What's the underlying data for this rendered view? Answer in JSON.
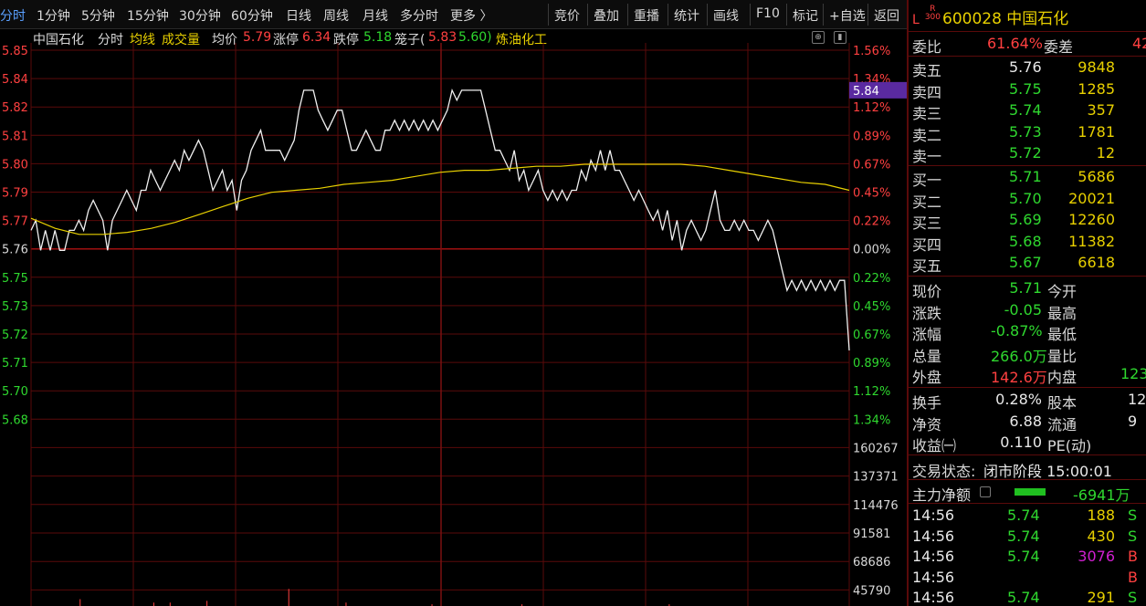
{
  "toolbar": {
    "left_items": [
      "分时",
      "1分钟",
      "5分钟",
      "15分钟",
      "30分钟",
      "60分钟",
      "日线",
      "周线",
      "月线",
      "多分时",
      "更多 〉"
    ],
    "right_items": [
      "竞价",
      "叠加",
      "重播",
      "统计",
      "画线",
      "F10",
      "标记",
      "+自选",
      "返回"
    ]
  },
  "chart_header": {
    "name": "中国石化",
    "mode": "分时",
    "avg_line": "均线",
    "volume": "成交量",
    "avg_label": "均价",
    "avg_value": "5.79",
    "limit_up_label": "涨停",
    "limit_up_value": "6.34",
    "limit_down_label": "跌停",
    "limit_down_value": "5.18",
    "cage_label": "笼子(",
    "cage_high": "5.83",
    "cage_low": "5.60)",
    "sector": "炼油化工"
  },
  "chart_data": {
    "type": "line",
    "price_ticks": [
      "5.85",
      "5.84",
      "5.82",
      "5.81",
      "5.80",
      "5.79",
      "5.77",
      "5.76",
      "5.75",
      "5.73",
      "5.72",
      "5.71",
      "5.70",
      "5.68"
    ],
    "pct_ticks": [
      "1.56%",
      "1.34%",
      "1.12%",
      "0.89%",
      "0.67%",
      "0.45%",
      "0.22%",
      "0.00%",
      "0.22%",
      "0.45%",
      "0.67%",
      "0.89%",
      "1.12%",
      "1.34%"
    ],
    "volume_ticks": [
      "160267",
      "137371",
      "114476",
      "91581",
      "68686",
      "45790"
    ],
    "price_marker": "5.84",
    "prev_close": 5.76,
    "price_range": [
      5.67,
      5.86
    ],
    "price_series": [
      5.77,
      5.775,
      5.76,
      5.77,
      5.76,
      5.77,
      5.76,
      5.76,
      5.77,
      5.77,
      5.775,
      5.77,
      5.78,
      5.785,
      5.78,
      5.775,
      5.76,
      5.775,
      5.78,
      5.785,
      5.79,
      5.785,
      5.78,
      5.79,
      5.79,
      5.8,
      5.795,
      5.79,
      5.795,
      5.8,
      5.805,
      5.8,
      5.81,
      5.805,
      5.81,
      5.815,
      5.81,
      5.8,
      5.79,
      5.795,
      5.8,
      5.79,
      5.795,
      5.78,
      5.795,
      5.8,
      5.81,
      5.815,
      5.82,
      5.81,
      5.81,
      5.81,
      5.81,
      5.805,
      5.81,
      5.815,
      5.83,
      5.84,
      5.84,
      5.84,
      5.83,
      5.825,
      5.82,
      5.825,
      5.83,
      5.83,
      5.82,
      5.81,
      5.81,
      5.815,
      5.82,
      5.815,
      5.81,
      5.81,
      5.82,
      5.82,
      5.825,
      5.82,
      5.825,
      5.82,
      5.825,
      5.82,
      5.825,
      5.82,
      5.825,
      5.82,
      5.825,
      5.83,
      5.84,
      5.835,
      5.84,
      5.84,
      5.84,
      5.84,
      5.84,
      5.83,
      5.82,
      5.81,
      5.81,
      5.805,
      5.8,
      5.81,
      5.795,
      5.8,
      5.79,
      5.795,
      5.8,
      5.79,
      5.785,
      5.79,
      5.785,
      5.79,
      5.785,
      5.79,
      5.79,
      5.8,
      5.795,
      5.805,
      5.8,
      5.81,
      5.8,
      5.81,
      5.8,
      5.8,
      5.795,
      5.79,
      5.785,
      5.79,
      5.785,
      5.78,
      5.775,
      5.78,
      5.77,
      5.78,
      5.765,
      5.775,
      5.76,
      5.77,
      5.775,
      5.77,
      5.765,
      5.77,
      5.78,
      5.79,
      5.775,
      5.77,
      5.77,
      5.775,
      5.77,
      5.775,
      5.77,
      5.77,
      5.765,
      5.77,
      5.775,
      5.77,
      5.76,
      5.75,
      5.74,
      5.745,
      5.74,
      5.745,
      5.74,
      5.745,
      5.74,
      5.745,
      5.74,
      5.745,
      5.74,
      5.745,
      5.745,
      5.71
    ],
    "avg_series": [
      5.776,
      5.771,
      5.768,
      5.768,
      5.769,
      5.771,
      5.774,
      5.778,
      5.782,
      5.786,
      5.789,
      5.79,
      5.791,
      5.793,
      5.794,
      5.795,
      5.797,
      5.799,
      5.8,
      5.8,
      5.801,
      5.802,
      5.802,
      5.803,
      5.803,
      5.803,
      5.803,
      5.803,
      5.802,
      5.8,
      5.798,
      5.796,
      5.794,
      5.793,
      5.79
    ],
    "volume_bars": [
      [
        0.06,
        0.04
      ],
      [
        0.15,
        0.02
      ],
      [
        0.17,
        0.02
      ],
      [
        0.215,
        0.03
      ],
      [
        0.315,
        0.1
      ],
      [
        0.385,
        0.02
      ],
      [
        0.49,
        0.01
      ],
      [
        0.6,
        0.01
      ],
      [
        0.78,
        0.01
      ]
    ]
  },
  "right_panel": {
    "code": "600028",
    "name": "中国石化",
    "badge_top": "R",
    "badge_bottom": "300",
    "badge_left": "L",
    "weibi_label": "委比",
    "weibi_value": "61.64%",
    "weicha_label": "委差",
    "weicha_value": "42",
    "asks": [
      {
        "label": "卖五",
        "price": "5.76",
        "vol": "9848"
      },
      {
        "label": "卖四",
        "price": "5.75",
        "vol": "1285"
      },
      {
        "label": "卖三",
        "price": "5.74",
        "vol": "357"
      },
      {
        "label": "卖二",
        "price": "5.73",
        "vol": "1781"
      },
      {
        "label": "卖一",
        "price": "5.72",
        "vol": "12"
      }
    ],
    "bids": [
      {
        "label": "买一",
        "price": "5.71",
        "vol": "5686"
      },
      {
        "label": "买二",
        "price": "5.70",
        "vol": "20021"
      },
      {
        "label": "买三",
        "price": "5.69",
        "vol": "12260"
      },
      {
        "label": "买四",
        "price": "5.68",
        "vol": "11382"
      },
      {
        "label": "买五",
        "price": "5.67",
        "vol": "6618"
      }
    ],
    "quote": [
      {
        "l1": "现价",
        "v1": "5.71",
        "l2": "今开",
        "v2": ""
      },
      {
        "l1": "涨跌",
        "v1": "-0.05",
        "l2": "最高",
        "v2": ""
      },
      {
        "l1": "涨幅",
        "v1": "-0.87%",
        "l2": "最低",
        "v2": ""
      },
      {
        "l1": "总量",
        "v1": "266.0万",
        "l2": "量比",
        "v2": ""
      },
      {
        "l1": "外盘",
        "v1": "142.6万",
        "l2": "内盘",
        "v2": "123"
      }
    ],
    "fund": [
      {
        "l1": "换手",
        "v1": "0.28%",
        "l2": "股本",
        "v2": "12"
      },
      {
        "l1": "净资",
        "v1": "6.88",
        "l2": "流通",
        "v2": "9"
      },
      {
        "l1": "收益㈠",
        "v1": "0.110",
        "l2": "PE(动)",
        "v2": ""
      }
    ],
    "status_label": "交易状态:",
    "status_value": "闭市阶段 15:00:01",
    "mainforce_label": "主力净额",
    "mainforce_value": "-6941万",
    "ticks": [
      {
        "time": "14:56",
        "price": "5.74",
        "vol": "188",
        "side": "S"
      },
      {
        "time": "14:56",
        "price": "5.74",
        "vol": "430",
        "side": "S"
      },
      {
        "time": "14:56",
        "price": "5.74",
        "vol": "3076",
        "side": "B"
      },
      {
        "time": "14:56",
        "price": "",
        "vol": "",
        "side": "B"
      },
      {
        "time": "14:56",
        "price": "5.74",
        "vol": "291",
        "side": "S"
      }
    ]
  }
}
